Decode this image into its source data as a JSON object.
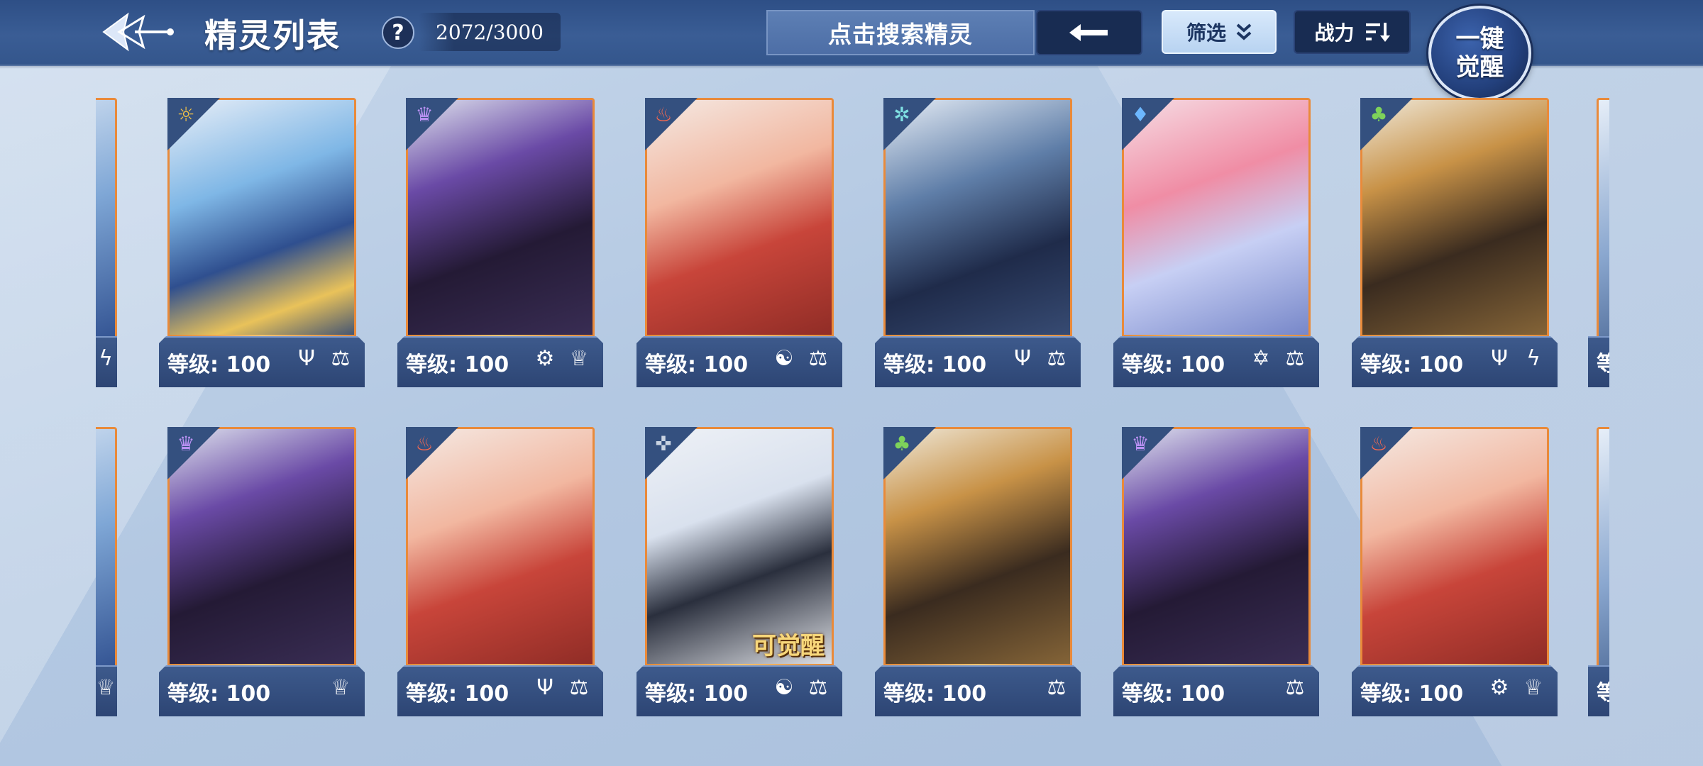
{
  "header": {
    "title": "精灵列表",
    "help_label": "?",
    "count": "2072/3000",
    "search_placeholder": "点击搜索精灵",
    "filter_label": "筛选",
    "power_label": "战力",
    "awaken_line1": "一键",
    "awaken_line2": "觉醒"
  },
  "colors": {
    "accent_orange": "#e98a3a",
    "header_blue": "#2e4f86",
    "plate_blue": "#2d4574"
  },
  "cards": [
    {
      "element": "light",
      "element_icon": "sun-element-icon",
      "level_text": "等级: 100",
      "skills": [
        "trident-skill-icon",
        "scale-lore-skill-icon"
      ],
      "awakenable": false
    },
    {
      "element": "dark",
      "element_icon": "demon-element-icon",
      "level_text": "等级: 100",
      "skills": [
        "gear-skill-icon",
        "crown-skill-icon"
      ],
      "awakenable": false
    },
    {
      "element": "fire",
      "element_icon": "flame-element-icon",
      "level_text": "等级: 100",
      "skills": [
        "swirl-skill-icon",
        "balance-skill-icon"
      ],
      "awakenable": false
    },
    {
      "element": "wind",
      "element_icon": "snowflake-element-icon",
      "level_text": "等级: 100",
      "skills": [
        "trident-skill-icon",
        "scale-lore-skill-icon"
      ],
      "awakenable": false
    },
    {
      "element": "water",
      "element_icon": "water-element-icon",
      "level_text": "等级: 100",
      "skills": [
        "star-skill-icon",
        "balance-skill-icon"
      ],
      "awakenable": false
    },
    {
      "element": "grass",
      "element_icon": "leaf-element-icon",
      "level_text": "等级: 100",
      "skills": [
        "trident-skill-icon",
        "lightning-skill-icon"
      ],
      "awakenable": false
    },
    {
      "element": "dark",
      "element_icon": "demon-element-icon",
      "level_text": "等级: 100",
      "skills": [
        "crown-skill-icon"
      ],
      "awakenable": false
    },
    {
      "element": "fire",
      "element_icon": "flame-element-icon",
      "level_text": "等级: 100",
      "skills": [
        "trident-skill-icon",
        "scale-lore-skill-icon"
      ],
      "awakenable": false
    },
    {
      "element": "mechanical",
      "element_icon": "mech-element-icon",
      "level_text": "等级: 100",
      "skills": [
        "swirl-skill-icon",
        "scale-lore-skill-icon"
      ],
      "awakenable": true,
      "awaken_text": "可觉醒"
    },
    {
      "element": "grass",
      "element_icon": "leaf-element-icon",
      "level_text": "等级: 100",
      "skills": [
        "scale-lore-skill-icon"
      ],
      "awakenable": false
    },
    {
      "element": "dark",
      "element_icon": "demon-element-icon",
      "level_text": "等级: 100",
      "skills": [
        "balance-skill-icon"
      ],
      "awakenable": false
    },
    {
      "element": "fire",
      "element_icon": "flame-element-icon",
      "level_text": "等级: 100",
      "skills": [
        "gear-skill-icon",
        "crown-skill-icon"
      ],
      "awakenable": false
    }
  ],
  "edge_left_skills": [
    "lightning-skill-icon",
    "crown-skill-icon"
  ],
  "edge_right_levels": [
    "等",
    "等"
  ]
}
